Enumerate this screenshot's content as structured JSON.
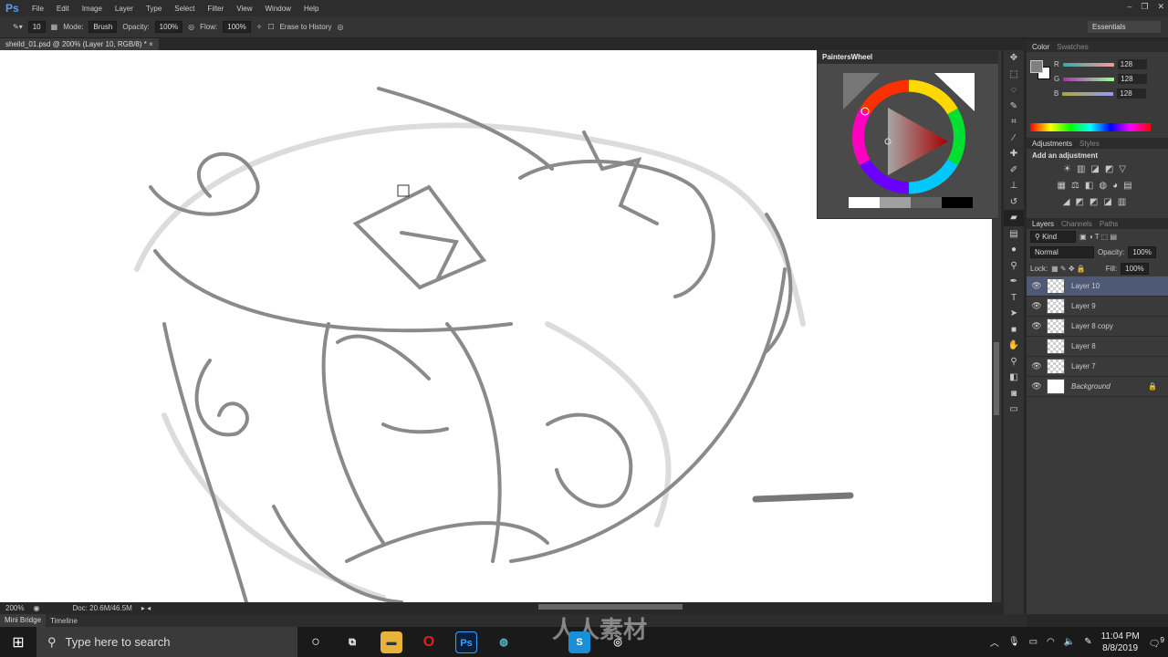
{
  "app": {
    "logo": "Ps",
    "menu": [
      "File",
      "Edit",
      "Image",
      "Layer",
      "Type",
      "Select",
      "Filter",
      "View",
      "Window",
      "Help"
    ],
    "watermark": "www.rrcg.cn",
    "workspace": "Essentials"
  },
  "options": {
    "brush_size": "10",
    "mode_label": "Mode:",
    "mode": "Brush",
    "opacity_label": "Opacity:",
    "opacity": "100%",
    "flow_label": "Flow:",
    "flow": "100%",
    "erase_history": "Erase to History"
  },
  "document": {
    "tab": "sheild_01.psd @ 200% (Layer 10, RGB/8) *",
    "zoom": "200%",
    "doc_size": "Doc: 20.6M/46.5M"
  },
  "bottom_tabs": [
    "Mini Bridge",
    "Timeline"
  ],
  "painters_wheel": {
    "title": "PaintersWheel",
    "swatch_colors": [
      "#ffffff",
      "#a0a0a0",
      "#606060",
      "#000000"
    ]
  },
  "color_panel": {
    "tabs": [
      "Color",
      "Swatches"
    ],
    "r_label": "R",
    "g_label": "G",
    "b_label": "B",
    "r": "128",
    "g": "128",
    "b": "128",
    "foreground": "#808080",
    "background": "#ffffff"
  },
  "adjustments": {
    "tabs": [
      "Adjustments",
      "Styles"
    ],
    "heading": "Add an adjustment"
  },
  "layers_panel": {
    "tabs": [
      "Layers",
      "Channels",
      "Paths"
    ],
    "filter": "Kind",
    "blend": "Normal",
    "opacity_label": "Opacity:",
    "opacity": "100%",
    "lock_label": "Lock:",
    "fill_label": "Fill:",
    "fill": "100%",
    "layers": [
      {
        "name": "Layer 10",
        "visible": true,
        "selected": true
      },
      {
        "name": "Layer 9",
        "visible": true
      },
      {
        "name": "Layer 8 copy",
        "visible": true
      },
      {
        "name": "Layer 8",
        "visible": false
      },
      {
        "name": "Layer 7",
        "visible": true
      },
      {
        "name": "Background",
        "visible": true,
        "locked": true
      }
    ]
  },
  "taskbar": {
    "search_placeholder": "Type here to search",
    "time": "11:04 PM",
    "date": "8/8/2019",
    "notifications": "9",
    "center_watermark": "人人素材"
  }
}
